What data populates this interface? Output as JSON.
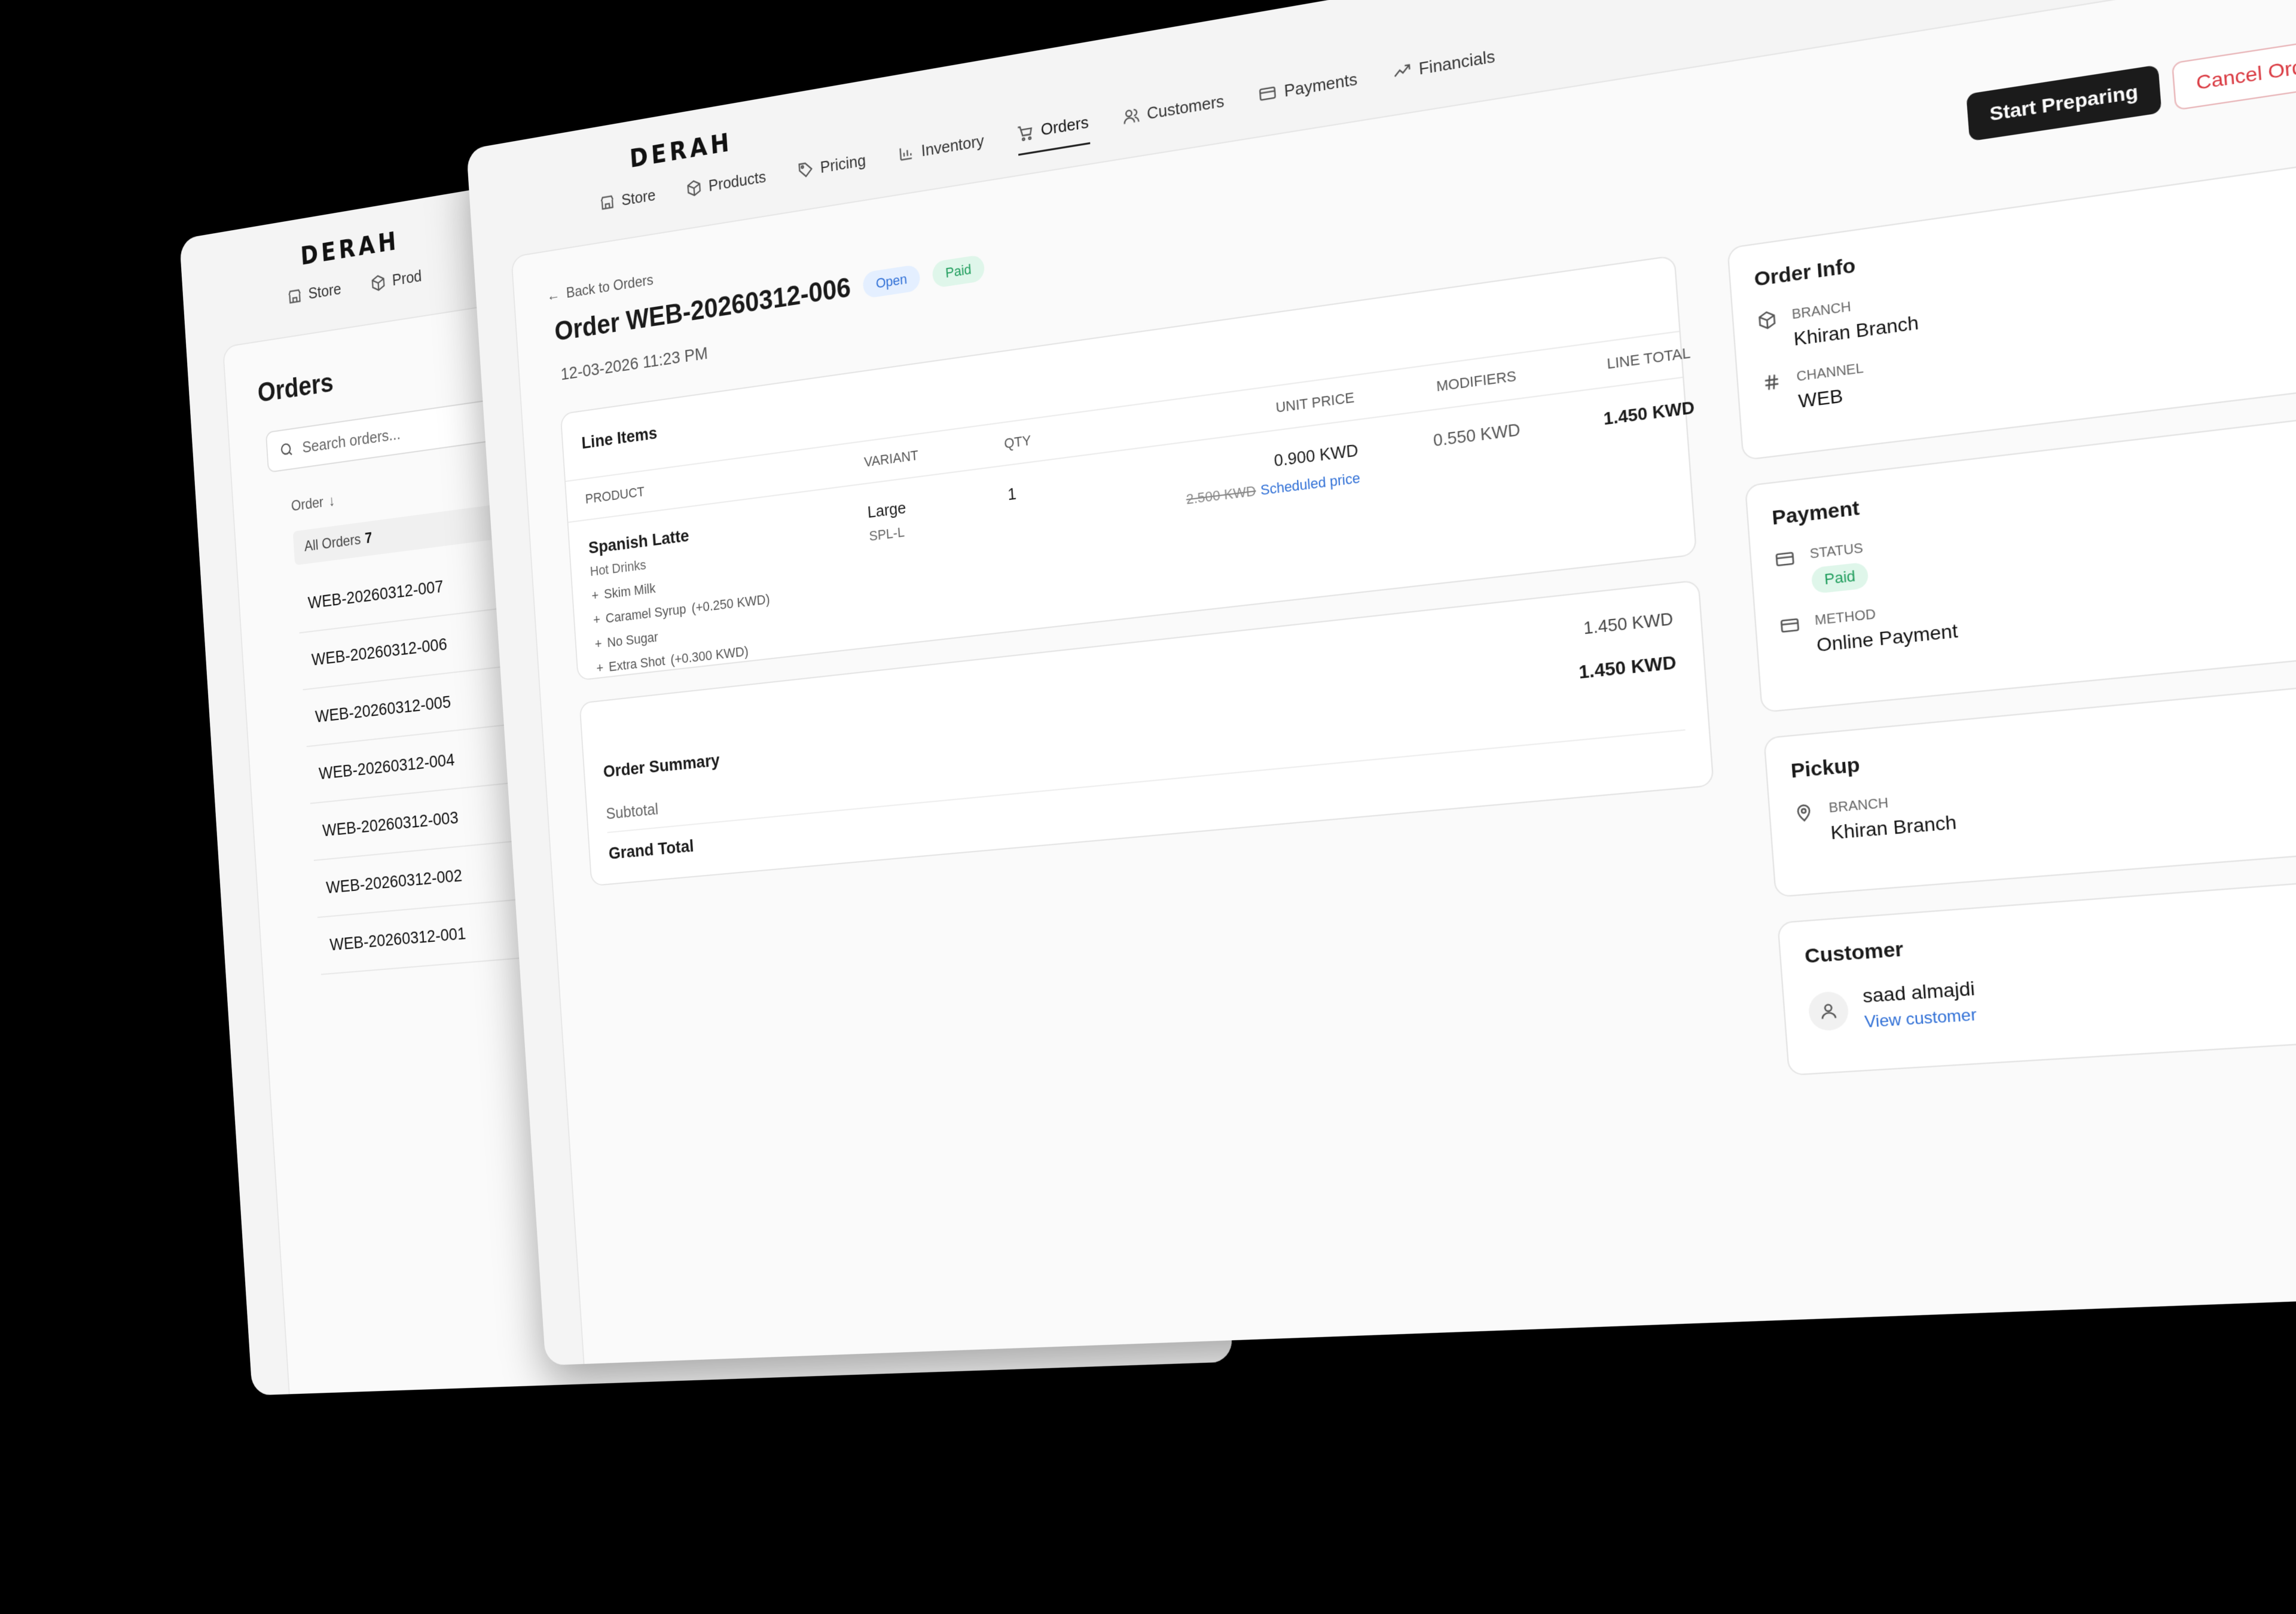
{
  "brand": {
    "logo": "DERAH"
  },
  "back_window": {
    "nav": [
      {
        "label": "Store"
      },
      {
        "label": "Prod"
      }
    ],
    "title": "Orders",
    "search_placeholder": "Search orders...",
    "column_header": "Order",
    "filter": {
      "label": "All Orders",
      "count": "7"
    },
    "orders": [
      "WEB-20260312-007",
      "WEB-20260312-006",
      "WEB-20260312-005",
      "WEB-20260312-004",
      "WEB-20260312-003",
      "WEB-20260312-002",
      "WEB-20260312-001"
    ]
  },
  "front_window": {
    "nav": [
      {
        "label": "Store",
        "icon": "store-icon"
      },
      {
        "label": "Products",
        "icon": "box-icon"
      },
      {
        "label": "Pricing",
        "icon": "tag-icon"
      },
      {
        "label": "Inventory",
        "icon": "bar-chart-icon"
      },
      {
        "label": "Orders",
        "icon": "cart-icon",
        "active": true
      },
      {
        "label": "Customers",
        "icon": "users-icon"
      },
      {
        "label": "Payments",
        "icon": "card-icon"
      },
      {
        "label": "Financials",
        "icon": "trend-icon"
      }
    ],
    "actions": {
      "start": "Start Preparing",
      "cancel": "Cancel Order"
    },
    "back_link": "Back to Orders",
    "order": {
      "title": "Order WEB-20260312-006",
      "status_open": "Open",
      "status_paid": "Paid",
      "date": "12-03-2026 11:23 PM"
    },
    "line_items": {
      "title": "Line Items",
      "headers": {
        "product": "PRODUCT",
        "variant": "VARIANT",
        "qty": "QTY",
        "unit_price": "UNIT PRICE",
        "modifiers": "MODIFIERS",
        "line_total": "LINE TOTAL"
      },
      "item": {
        "name": "Spanish Latte",
        "category": "Hot Drinks",
        "variant": "Large",
        "sku": "SPL-L",
        "qty": "1",
        "unit_price": "0.900 KWD",
        "original_price": "2.500 KWD",
        "price_note": "Scheduled price",
        "modifiers_total": "0.550 KWD",
        "line_total": "1.450 KWD",
        "modifiers": [
          {
            "name": "Skim Milk",
            "price": ""
          },
          {
            "name": "Caramel Syrup",
            "price": "(+0.250 KWD)"
          },
          {
            "name": "No Sugar",
            "price": ""
          },
          {
            "name": "Extra Shot",
            "price": "(+0.300 KWD)"
          }
        ]
      }
    },
    "summary": {
      "title": "Order Summary",
      "subtotal_label": "Subtotal",
      "subtotal_value": "1.450 KWD",
      "grand_label": "Grand Total",
      "grand_value": "1.450 KWD"
    },
    "order_info": {
      "title": "Order Info",
      "branch_label": "BRANCH",
      "branch": "Khiran Branch",
      "channel_label": "CHANNEL",
      "channel": "WEB"
    },
    "payment": {
      "title": "Payment",
      "status_label": "STATUS",
      "status": "Paid",
      "method_label": "METHOD",
      "method": "Online Payment"
    },
    "pickup": {
      "title": "Pickup",
      "branch_label": "BRANCH",
      "branch": "Khiran Branch"
    },
    "customer": {
      "title": "Customer",
      "name": "saad almajdi",
      "link": "View customer"
    }
  }
}
